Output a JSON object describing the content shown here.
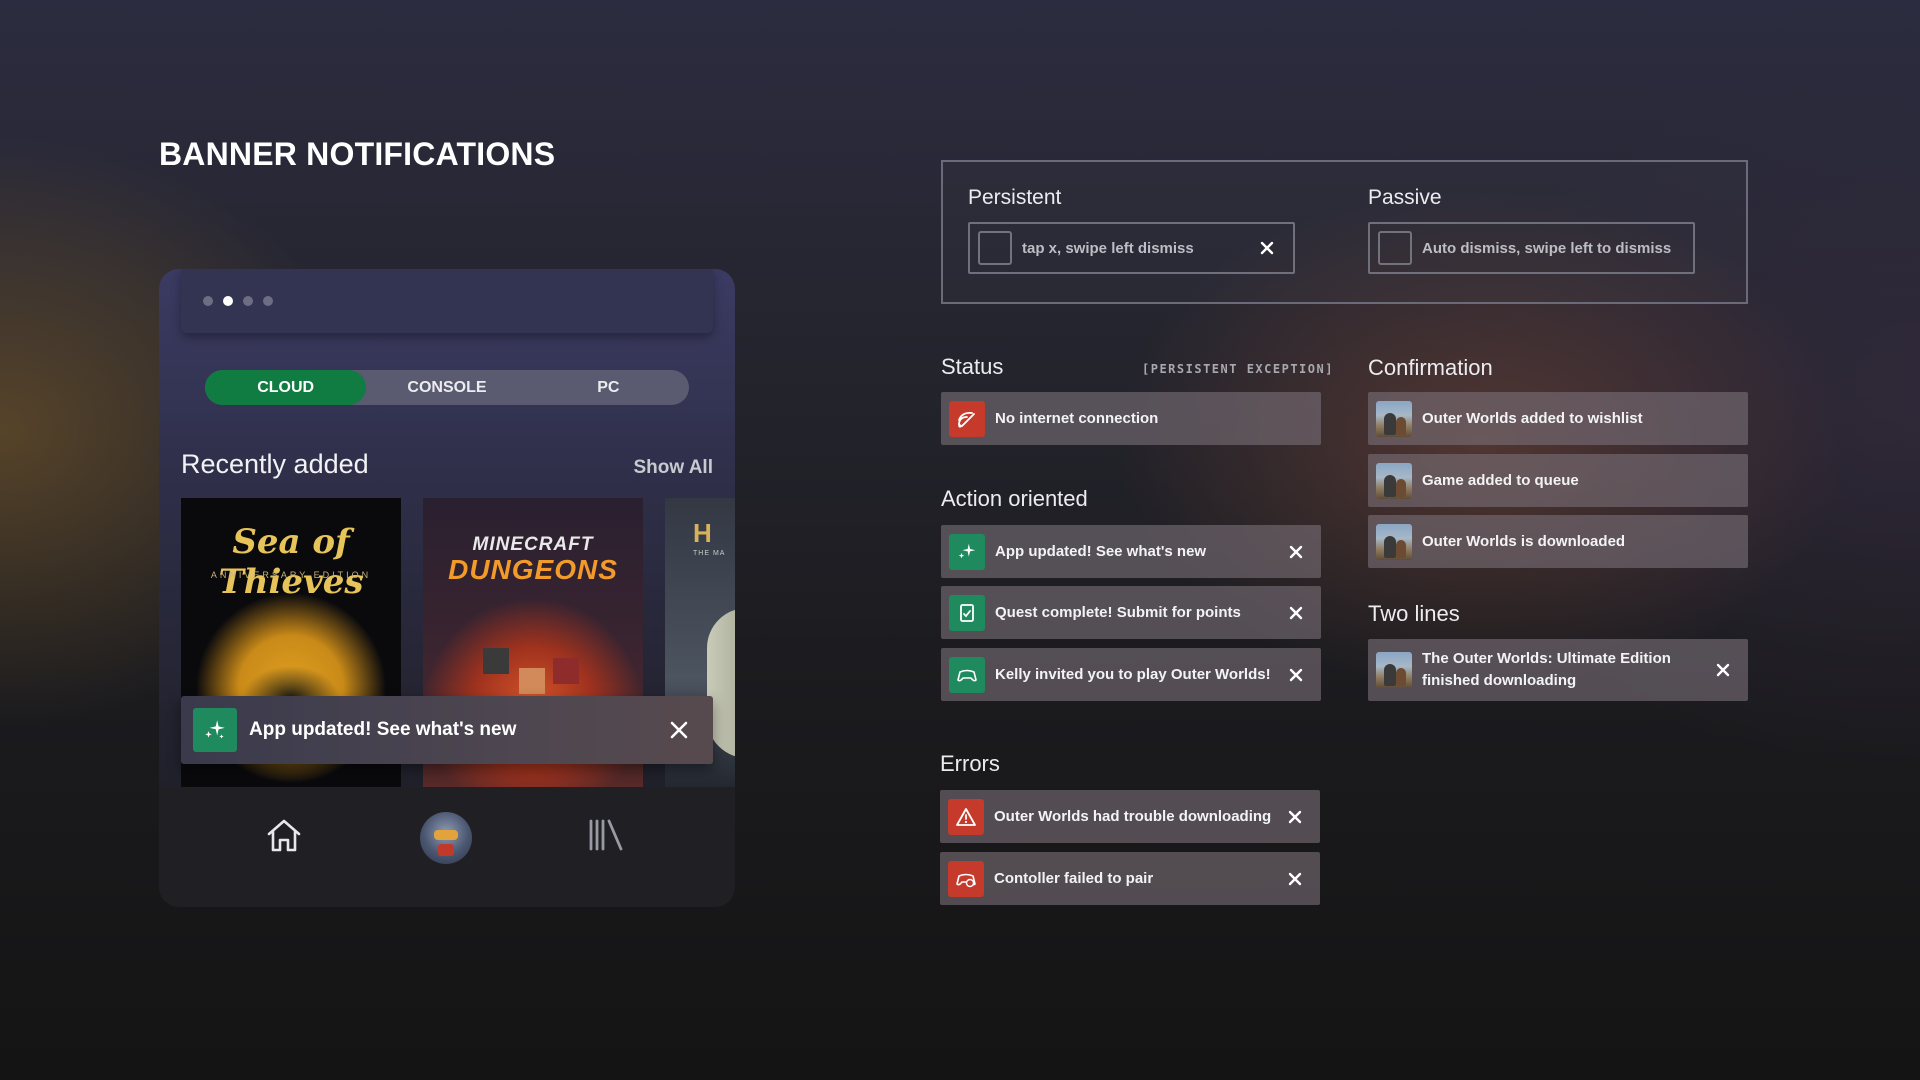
{
  "page": {
    "title": "BANNER NOTIFICATIONS"
  },
  "phone": {
    "segments": [
      "CLOUD",
      "CONSOLE",
      "PC"
    ],
    "active_segment": "CLOUD",
    "section_title": "Recently added",
    "show_all": "Show All",
    "tiles": {
      "sea_of_thieves": {
        "logo": "Sea of Thieves",
        "subtitle": "ANNIVERSARY EDITION"
      },
      "minecraft_dungeons": {
        "logo_top": "MINECRAFT",
        "logo_bottom": "DUNGEONS"
      },
      "halo": {
        "logo": "H",
        "subtitle": "THE MA"
      }
    },
    "toast": {
      "text": "App updated! See what's new",
      "icon": "sparkle-icon"
    },
    "nav": {
      "home_icon": "home-icon",
      "avatar": "avatar",
      "library_icon": "library-icon"
    },
    "pager_active_index": 1
  },
  "legend": {
    "persistent": {
      "label": "Persistent",
      "field_text": "tap x, swipe left dismiss"
    },
    "passive": {
      "label": "Passive",
      "field_text": "Auto dismiss, swipe left to dismiss"
    }
  },
  "status": {
    "title": "Status",
    "tag": "[PERSISTENT EXCEPTION]",
    "items": [
      {
        "text": "No internet connection",
        "icon": "no-wifi-icon"
      }
    ]
  },
  "action_oriented": {
    "title": "Action oriented",
    "items": [
      {
        "text": "App updated! See what's new",
        "icon": "sparkle-icon"
      },
      {
        "text": "Quest complete! Submit for points",
        "icon": "quest-icon"
      },
      {
        "text": "Kelly invited you to play Outer Worlds!",
        "icon": "controller-icon"
      }
    ]
  },
  "errors": {
    "title": "Errors",
    "items": [
      {
        "text": "Outer Worlds had trouble downloading",
        "icon": "warning-icon"
      },
      {
        "text": "Contoller failed to pair",
        "icon": "controller-error-icon"
      }
    ]
  },
  "confirmation": {
    "title": "Confirmation",
    "items": [
      {
        "text": "Outer Worlds added to wishlist"
      },
      {
        "text": "Game added to queue"
      },
      {
        "text": "Outer Worlds is downloaded"
      }
    ]
  },
  "two_lines": {
    "title": "Two lines",
    "line1": "The Outer Worlds: Ultimate Edition",
    "line2": "finished downloading"
  },
  "colors": {
    "accent_green": "#107c41",
    "icon_green": "#1f8a5e",
    "icon_red": "#c63a2b"
  }
}
